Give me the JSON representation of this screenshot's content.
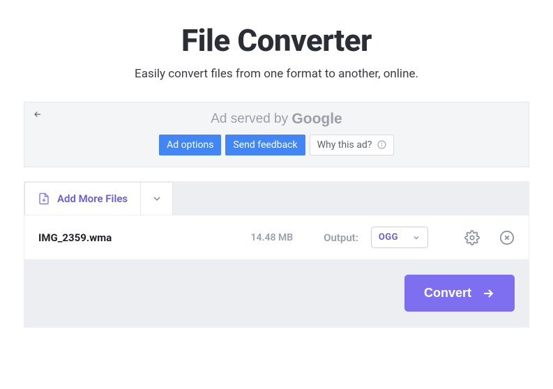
{
  "hero": {
    "title": "File Converter",
    "subtitle": "Easily convert files from one format to another, online."
  },
  "ad": {
    "served_prefix": "Ad served by ",
    "served_brand": "Google",
    "options_label": "Ad options",
    "feedback_label": "Send feedback",
    "why_label": "Why this ad?"
  },
  "toolbar": {
    "add_files_label": "Add More Files"
  },
  "file": {
    "name": "IMG_2359.wma",
    "size": "14.48 MB",
    "output_label": "Output:",
    "output_format": "OGG"
  },
  "actions": {
    "convert_label": "Convert"
  }
}
